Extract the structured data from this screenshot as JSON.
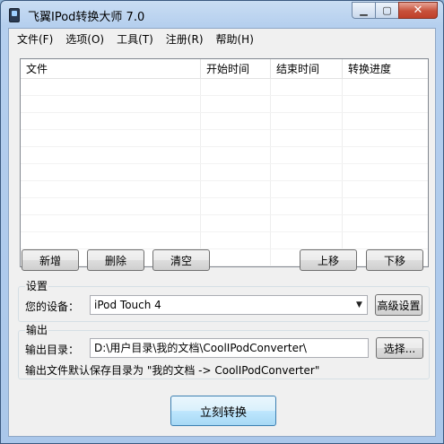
{
  "window": {
    "title": "飞翼IPod转换大师 7.0",
    "minimize_glyph": "▁",
    "maximize_glyph": "▢",
    "close_glyph": "✕"
  },
  "menu": [
    "文件(F)",
    "选项(O)",
    "工具(T)",
    "注册(R)",
    "帮助(H)"
  ],
  "file_list": {
    "columns": [
      "文件",
      "开始时间",
      "结束时间",
      "转换进度"
    ],
    "rows": []
  },
  "toolbar": {
    "add_label": "新增",
    "delete_label": "删除",
    "clear_label": "清空",
    "move_up_label": "上移",
    "move_down_label": "下移"
  },
  "settings": {
    "group_title": "设置",
    "device_label": "您的设备：",
    "device_value": "iPod Touch 4",
    "advanced_label": "高级设置"
  },
  "output": {
    "group_title": "输出",
    "dir_label": "输出目录：",
    "dir_value": "D:\\用户目录\\我的文档\\CoolIPodConverter\\",
    "browse_label": "选择...",
    "default_note": "输出文件默认保存目录为 \"我的文档 -> CoolIPodConverter\""
  },
  "convert_button_label": "立刻转换",
  "icons": {
    "app": "ipod-app-icon",
    "dropdown": "chevron-down-icon"
  }
}
